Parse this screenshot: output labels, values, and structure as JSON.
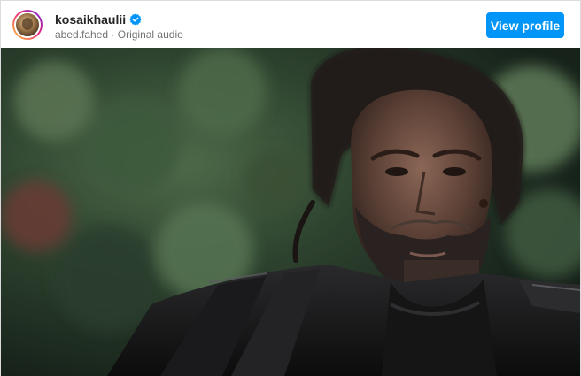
{
  "post_header": {
    "username": "kosaikhaulii",
    "verified": true,
    "audio_author": "abed.fahed",
    "separator": "·",
    "audio_label": "Original audio",
    "view_profile_label": "View profile"
  },
  "icons": {
    "avatar": "profile-avatar",
    "verified": "verified-badge-icon"
  },
  "colors": {
    "button_blue": "#0095f6",
    "verified_blue": "#0095f6",
    "text_primary": "#262626",
    "text_secondary": "#737373"
  }
}
